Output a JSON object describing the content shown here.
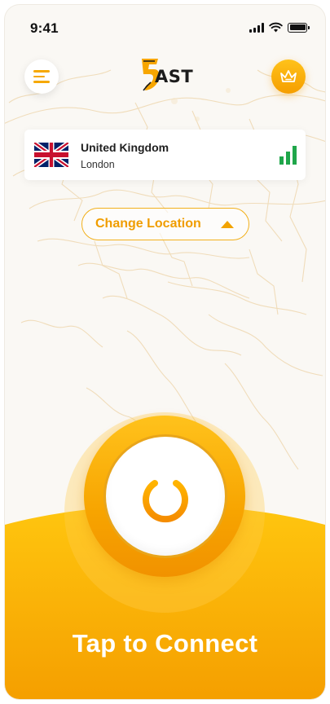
{
  "status_bar": {
    "time": "9:41"
  },
  "header": {
    "logo_text": "AST"
  },
  "location": {
    "country": "United Kingdom",
    "city": "London",
    "signal_bars": 3
  },
  "change_location": {
    "label": "Change Location"
  },
  "connect": {
    "label": "Tap to Connect"
  },
  "colors": {
    "accent": "#f6a800",
    "accent_light": "#ffc21a",
    "signal_green": "#1fa64a",
    "background": "#faf8f4"
  },
  "icons": {
    "menu": "menu-icon",
    "premium": "crown-icon",
    "power": "power-icon",
    "flag": "uk-flag-icon"
  }
}
